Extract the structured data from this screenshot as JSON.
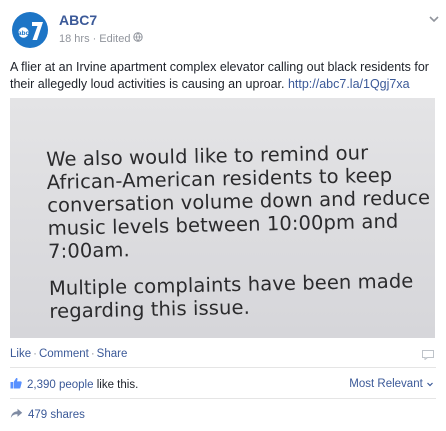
{
  "post": {
    "page_name": "ABC7",
    "time": "18 hrs",
    "edited": "Edited",
    "meta_separator": "·",
    "text": "A flier at an Irvine apartment complex elevator calling out black residents for their allegedly loud activities is causing an uproar.",
    "link": "http://abc7.la/1Qgj7xa",
    "logo_text": "abc 7"
  },
  "flyer": {
    "paragraph1": [
      "We also would like to remind our",
      "African-American residents to keep",
      "conversation volume down and reduce",
      "music levels between 10:00pm and",
      "7:00am."
    ],
    "paragraph2": [
      "Multiple complaints have been made",
      "regarding this issue."
    ]
  },
  "actions": {
    "like": "Like",
    "comment": "Comment",
    "share": "Share",
    "separator": "·"
  },
  "engagement": {
    "likes_count": "2,390 people",
    "likes_suffix": "like this.",
    "sort": "Most Relevant",
    "shares": "479 shares"
  },
  "colors": {
    "link": "#3b5998",
    "meta": "#90949c",
    "logo": "#1d75c6"
  },
  "icons": [
    "abc7-logo",
    "globe-icon",
    "chevron-down-icon",
    "comment-box-icon",
    "thumbs-up-icon",
    "share-arrow-icon"
  ]
}
